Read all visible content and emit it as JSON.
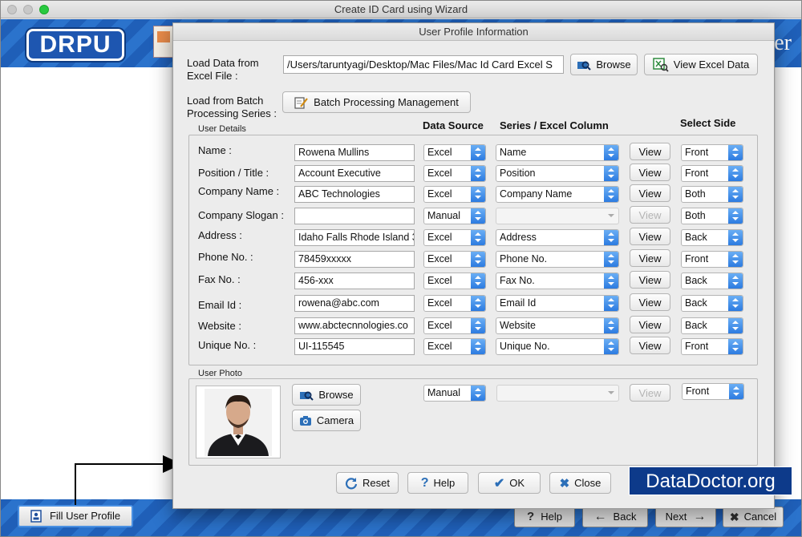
{
  "outer_window": {
    "title": "Create ID Card using Wizard",
    "logo_text": "DRPU",
    "banner_tail": "er"
  },
  "bottom_bar": {
    "fill_profile_label": "Fill User Profile",
    "help_label": "Help",
    "back_label": "Back",
    "next_label": "Next",
    "cancel_label": "Cancel"
  },
  "dialog": {
    "title": "User Profile Information",
    "load_excel_label": "Load Data from Excel File :",
    "excel_path": "/Users/taruntyagi/Desktop/Mac Files/Mac Id Card Excel S",
    "browse_label": "Browse",
    "view_excel_label": "View Excel Data",
    "load_batch_label": "Load from Batch Processing Series :",
    "batch_button_label": "Batch Processing Management",
    "user_details_title": "User Details",
    "col_headers": {
      "data_source": "Data Source",
      "series_column": "Series / Excel Column",
      "select_side": "Select Side"
    },
    "rows": [
      {
        "label": "Name :",
        "value": "Rowena Mullins",
        "source": "Excel",
        "column": "Name",
        "view": "View",
        "side": "Front",
        "enabled": true
      },
      {
        "label": "Position / Title :",
        "value": "Account Executive",
        "source": "Excel",
        "column": "Position",
        "view": "View",
        "side": "Front",
        "enabled": true
      },
      {
        "label": "Company Name :",
        "value": "ABC Technologies",
        "source": "Excel",
        "column": "Company Name",
        "view": "View",
        "side": "Both",
        "enabled": true
      },
      {
        "label": "Company Slogan :",
        "value": "",
        "source": "Manual",
        "column": "",
        "view": "View",
        "side": "Both",
        "enabled": false
      },
      {
        "label": "Address :",
        "value": "Idaho Falls Rhode Island 3",
        "source": "Excel",
        "column": "Address",
        "view": "View",
        "side": "Back",
        "enabled": true
      },
      {
        "label": "Phone No. :",
        "value": "78459xxxxx",
        "source": "Excel",
        "column": "Phone No.",
        "view": "View",
        "side": "Front",
        "enabled": true
      },
      {
        "label": "Fax No. :",
        "value": "456-xxx",
        "source": "Excel",
        "column": "Fax No.",
        "view": "View",
        "side": "Back",
        "enabled": true
      },
      {
        "label": "Email Id :",
        "value": "rowena@abc.com",
        "source": "Excel",
        "column": "Email Id",
        "view": "View",
        "side": "Back",
        "enabled": true
      },
      {
        "label": "Website :",
        "value": "www.abctecnnologies.co",
        "source": "Excel",
        "column": "Website",
        "view": "View",
        "side": "Back",
        "enabled": true
      },
      {
        "label": "Unique No. :",
        "value": "UI-115545",
        "source": "Excel",
        "column": "Unique No.",
        "view": "View",
        "side": "Front",
        "enabled": true
      }
    ],
    "user_photo_title": "User Photo",
    "photo_browse_label": "Browse",
    "photo_camera_label": "Camera",
    "photo_source": "Manual",
    "photo_column": "",
    "photo_view": "View",
    "photo_side": "Front",
    "reset_label": "Reset",
    "help_label": "Help",
    "ok_label": "OK",
    "close_label": "Close"
  },
  "watermark": "DataDoctor.org",
  "colors": {
    "accent_blue": "#2c7be0",
    "banner_blue": "#1f5fb8",
    "watermark_bg": "#0d3a8a"
  }
}
